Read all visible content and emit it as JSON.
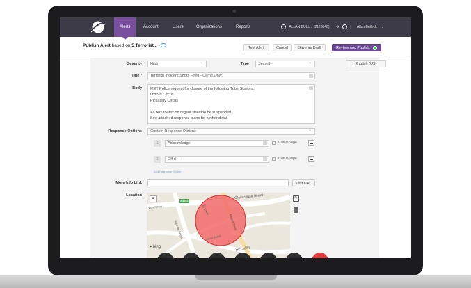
{
  "nav": {
    "items": [
      "Alerts",
      "Account",
      "Users",
      "Organizations",
      "Reports"
    ],
    "account_label": "ALLAN BULL... (2123848)",
    "user_name": "Allan Bulleck"
  },
  "toolbar": {
    "heading_prefix": "Publish Alert",
    "heading_based": "based on",
    "heading_template": "5 Terrorist...",
    "test_alert": "Test Alert",
    "cancel": "Cancel",
    "save_draft": "Save as Draft",
    "review_publish": "Review and Publish"
  },
  "form": {
    "severity_label": "Severity",
    "severity_value": "High",
    "type_label": "Type",
    "type_value": "Security",
    "language_value": "English (US)",
    "title_label": "Title *",
    "title_value": "Terrorist Incident Shots Fired - Demo Only.",
    "body_label": "Body",
    "body_lines": [
      "MET Police request for closure of the following Tube Stations:",
      "Oxford Circus",
      "Piccadilly Circus",
      "",
      "All Bus routes on regent street to be suspended",
      "See attached response plans for further detail"
    ],
    "response_label": "Response Options",
    "response_value": "Custom Response Options",
    "options": [
      {
        "number": "1",
        "value": "Acknowledge",
        "check_label": "Call Bridge"
      },
      {
        "number": "2",
        "value": "Off d",
        "check_label": "Call Bridge"
      }
    ],
    "add_response_link": "Add Response Option",
    "more_info_label": "More Info Link",
    "more_info_value": "",
    "test_url": "Test URL",
    "location_label": "Location"
  },
  "map": {
    "streets": [
      "Glasshouse Street",
      "Piccadilly",
      "Regent Street",
      "Vigo Street",
      "Sackville Street",
      "Lower Street",
      "Air Street"
    ],
    "road_badge": "A4201",
    "provider": "bing"
  },
  "colors": {
    "nav_bg": "#3d3a47",
    "accent": "#7b4fa0",
    "primary_button": "#6e4796",
    "status_green": "#3fbf4f",
    "radius_fill": "#f26b6b"
  }
}
